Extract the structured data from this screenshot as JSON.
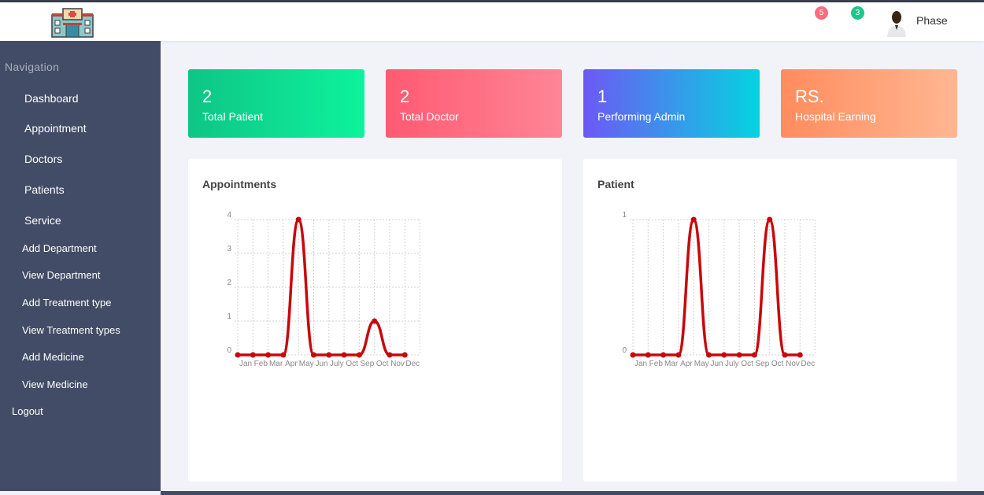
{
  "header": {
    "menu_icon": "",
    "expand_icon": "",
    "notif_icon": "",
    "notif_count": "5",
    "msg_icon": "",
    "msg_count": "3",
    "username": "Phase",
    "user_caret": ""
  },
  "sidebar": {
    "title": "Navigation",
    "items": [
      {
        "icon": "",
        "label": "Dashboard",
        "arrow": ""
      },
      {
        "icon": "",
        "label": "Appointment",
        "arrow": ""
      },
      {
        "icon": "",
        "label": "Doctors",
        "arrow": ""
      },
      {
        "icon": "",
        "label": "Patients",
        "arrow": ""
      },
      {
        "icon": "",
        "label": "Service",
        "arrow": ""
      }
    ],
    "subitems": [
      {
        "icon": "",
        "label": "Add Department"
      },
      {
        "icon": "",
        "label": "View Department"
      },
      {
        "icon": "",
        "label": "Add Treatment type"
      },
      {
        "icon": "",
        "label": "View Treatment types"
      },
      {
        "icon": "",
        "label": "Add Medicine"
      },
      {
        "icon": "",
        "label": "View Medicine"
      }
    ],
    "logout_icon": "",
    "logout": "Logout"
  },
  "cards": [
    {
      "value": "2",
      "label": "Total Patient"
    },
    {
      "value": "2",
      "label": "Total Doctor"
    },
    {
      "value": "1",
      "label": "Performing Admin"
    },
    {
      "value": "RS.",
      "label": "Hospital Earning"
    }
  ],
  "colors": {
    "line": "#c8080c",
    "sidebar": "#424c66"
  },
  "chart_data": [
    {
      "type": "line",
      "title": "Appointments",
      "categories": [
        "Jan",
        "Feb",
        "Mar",
        "Apr",
        "May",
        "Jun",
        "July",
        "Oct",
        "Sep",
        "Oct",
        "Nov",
        "Dec"
      ],
      "values": [
        0,
        0,
        0,
        0,
        4,
        0,
        0,
        0,
        0,
        1,
        0,
        0
      ],
      "ylim": [
        0,
        4
      ],
      "yticks": [
        "0",
        "1",
        "2",
        "3",
        "4"
      ],
      "grid": true
    },
    {
      "type": "line",
      "title": "Patient",
      "categories": [
        "Jan",
        "Feb",
        "Mar",
        "Apr",
        "May",
        "Jun",
        "July",
        "Oct",
        "Sep",
        "Oct",
        "Nov",
        "Dec"
      ],
      "values": [
        0,
        0,
        0,
        0,
        1,
        0,
        0,
        0,
        0,
        1,
        0,
        0
      ],
      "ylim": [
        0,
        1
      ],
      "yticks": [
        "0",
        "1"
      ],
      "grid": true
    }
  ]
}
